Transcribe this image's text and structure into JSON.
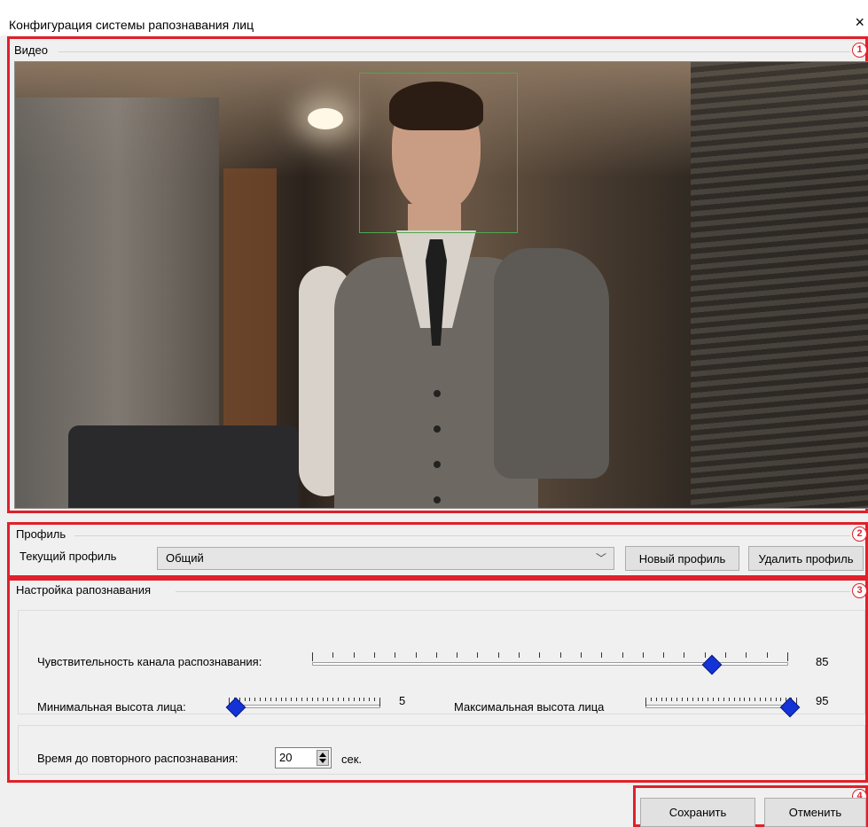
{
  "window": {
    "title": "Конфигурация системы рапознавания лиц",
    "close_icon": "×"
  },
  "annotations": {
    "labels": [
      "1",
      "2",
      "3",
      "4"
    ],
    "color": "#e0202a"
  },
  "video": {
    "label": "Видео",
    "face_box_color": "#4fa84f"
  },
  "profile": {
    "label": "Профиль",
    "current_label": "Текущий профиль",
    "current_value": "Общий",
    "dropdown_icon": "﹀",
    "new_button": "Новый профиль",
    "delete_button": "Удалить профиль"
  },
  "recognition": {
    "label": "Настройка рапознавания",
    "sensitivity": {
      "label": "Чувствительность канала распознавания:",
      "value": "85",
      "level": 0.85
    },
    "min_height": {
      "label": "Минимальная высота лица:",
      "value": "5",
      "level": 0.0
    },
    "max_height": {
      "label": "Максимальная высота лица",
      "value": "95",
      "level": 1.0
    },
    "repeat": {
      "label": "Время до повторного распознавания:",
      "value": "20",
      "unit": "сек."
    }
  },
  "footer": {
    "save_button": "Сохранить",
    "cancel_button": "Отменить"
  },
  "accent_color": "#1433d6"
}
